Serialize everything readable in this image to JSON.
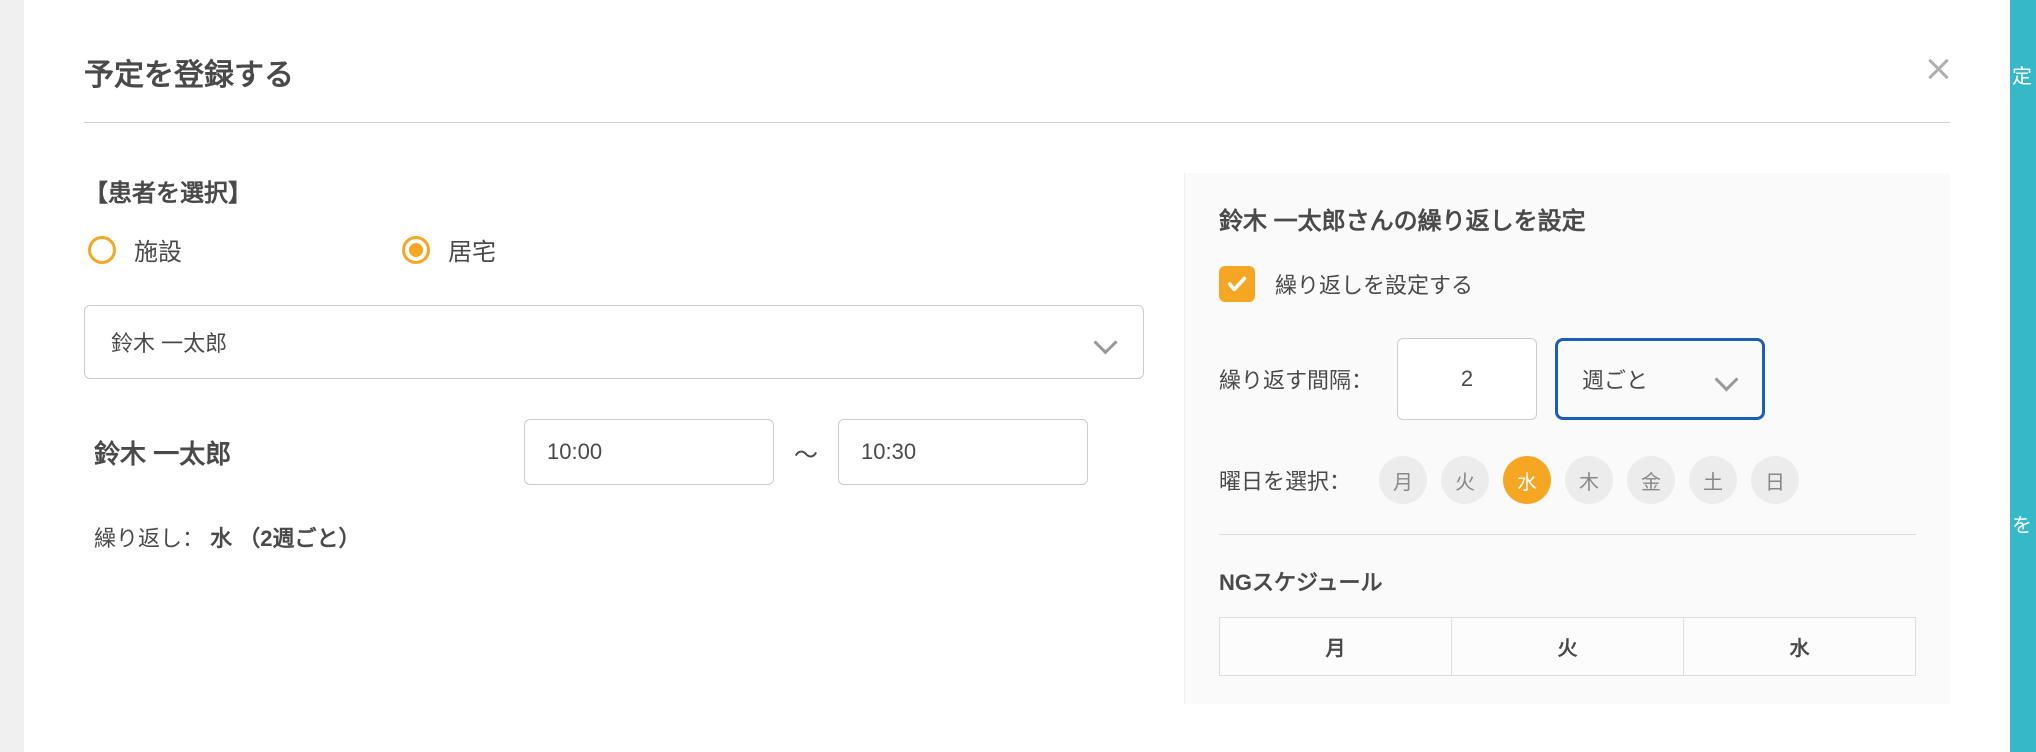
{
  "modal": {
    "title": "予定を登録する"
  },
  "patientSelect": {
    "sectionLabel": "【患者を選択】",
    "radio": {
      "facility": "施設",
      "home": "居宅",
      "selected": "home"
    },
    "dropdownValue": "鈴木 一太郎"
  },
  "timeSlot": {
    "patientName": "鈴木 一太郎",
    "startTime": "10:00",
    "separator": "〜",
    "endTime": "10:30"
  },
  "repeatSummary": {
    "label": "繰り返し：",
    "value": "水 （2週ごと）"
  },
  "repeatSettings": {
    "title": "鈴木 一太郎さんの繰り返しを設定",
    "checkboxLabel": "繰り返しを設定する",
    "intervalLabel": "繰り返す間隔：",
    "intervalValue": "2",
    "intervalUnit": "週ごと",
    "weekdayLabel": "曜日を選択：",
    "weekdays": [
      "月",
      "火",
      "水",
      "木",
      "金",
      "土",
      "日"
    ],
    "selectedWeekday": "水"
  },
  "ngSchedule": {
    "title": "NGスケジュール",
    "headers": [
      "月",
      "火",
      "水"
    ]
  },
  "bgFragments": {
    "rightText1": "定",
    "rightText2": "を"
  }
}
